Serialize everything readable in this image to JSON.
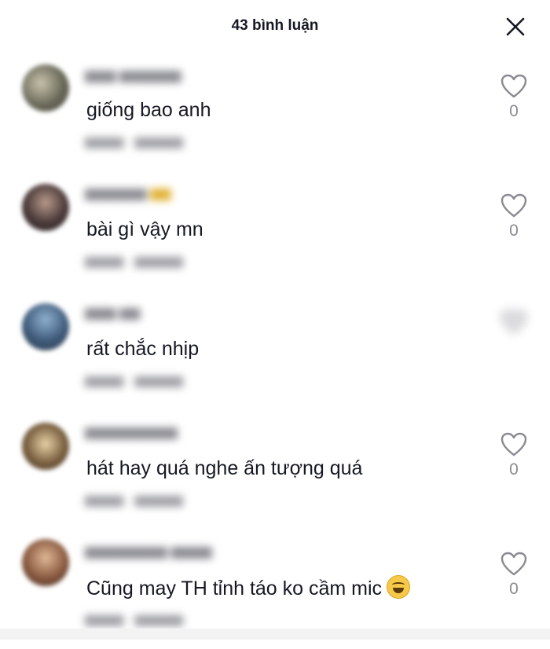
{
  "header": {
    "title": "43 bình luận",
    "close_icon": "close-icon"
  },
  "comments": [
    {
      "text": "giống bao anh",
      "likes": "0",
      "avatar_color": "#6b6a5a"
    },
    {
      "text": "bài gì vậy mn",
      "likes": "0",
      "avatar_color": "#4a3a3a"
    },
    {
      "text": "rất chắc nhịp",
      "likes": "",
      "avatar_color": "#3f5a7a"
    },
    {
      "text": "hát hay quá nghe ấn tượng quá",
      "likes": "0",
      "avatar_color": "#7a6040"
    },
    {
      "text": "Cũng may TH tỉnh táo ko cầm mic",
      "likes": "0",
      "avatar_color": "#8a5a40",
      "emoji": "laughing-emoji"
    }
  ],
  "colors": {
    "text": "#161823",
    "secondary": "#8a8b91"
  }
}
